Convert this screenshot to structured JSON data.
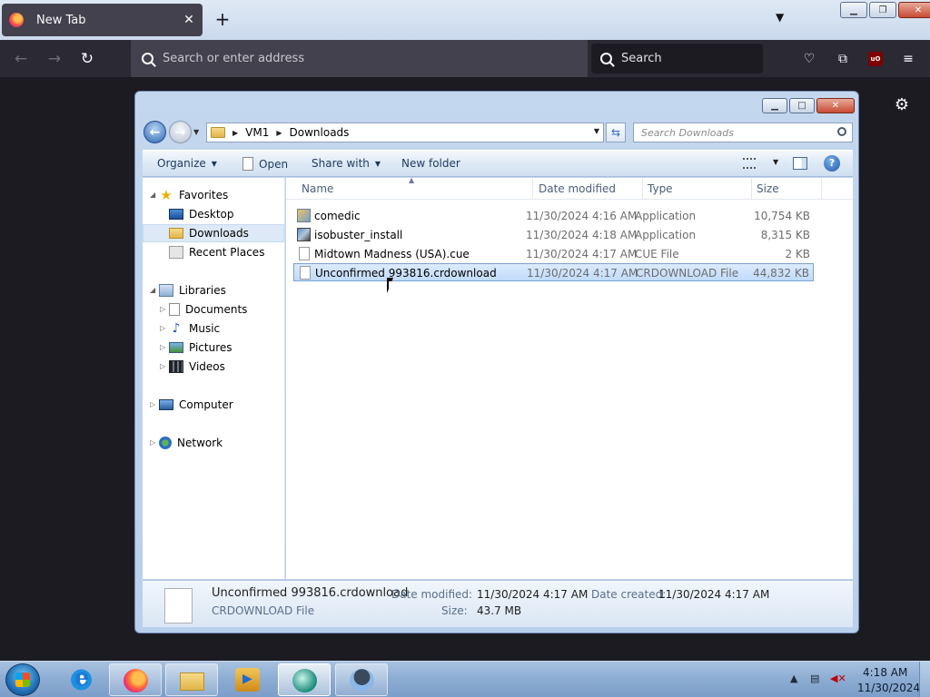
{
  "firefox": {
    "tab_title": "New Tab",
    "tab_close": "✕",
    "new_tab": "+",
    "tab_list": "⌄",
    "url_placeholder": "Search or enter address",
    "search_placeholder": "Search",
    "ublock_label": "uO"
  },
  "explorer": {
    "breadcrumb": [
      "VM1",
      "Downloads"
    ],
    "search_placeholder": "Search Downloads",
    "commands": {
      "organize": "Organize",
      "open": "Open",
      "share_with": "Share with",
      "new_folder": "New folder"
    },
    "nav": {
      "favorites": "Favorites",
      "desktop": "Desktop",
      "downloads": "Downloads",
      "recent_places": "Recent Places",
      "libraries": "Libraries",
      "documents": "Documents",
      "music": "Music",
      "pictures": "Pictures",
      "videos": "Videos",
      "computer": "Computer",
      "network": "Network"
    },
    "columns": {
      "name": "Name",
      "date_modified": "Date modified",
      "type": "Type",
      "size": "Size"
    },
    "files": [
      {
        "name": "comedic",
        "date": "11/30/2024 4:16 AM",
        "type": "Application",
        "size": "10,754 KB",
        "icon": "app-icon"
      },
      {
        "name": "isobuster_install",
        "date": "11/30/2024 4:18 AM",
        "type": "Application",
        "size": "8,315 KB",
        "icon": "installer-icon"
      },
      {
        "name": "Midtown Madness (USA).cue",
        "date": "11/30/2024 4:17 AM",
        "type": "CUE File",
        "size": "2 KB",
        "icon": "file-icon"
      },
      {
        "name": "Unconfirmed 993816.crdownload",
        "date": "11/30/2024 4:17 AM",
        "type": "CRDOWNLOAD File",
        "size": "44,832 KB",
        "icon": "file-icon",
        "selected": true
      }
    ],
    "details": {
      "name": "Unconfirmed 993816.crdownload",
      "type": "CRDOWNLOAD File",
      "date_modified_label": "Date modified:",
      "date_modified": "11/30/2024 4:17 AM",
      "date_created_label": "Date created:",
      "date_created": "11/30/2024 4:17 AM",
      "size_label": "Size:",
      "size": "43.7 MB"
    }
  },
  "taskbar": {
    "time": "4:18 AM",
    "date": "11/30/2024"
  },
  "colors": {
    "firefox_toolbar": "#2b2a33",
    "selection": "#c1dbfc",
    "taskbar": "#8cacd2"
  }
}
